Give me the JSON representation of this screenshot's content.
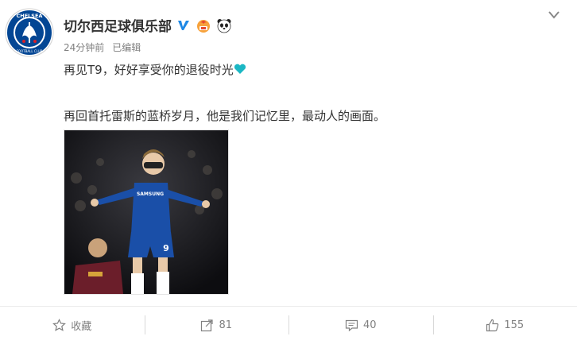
{
  "post": {
    "author_name": "切尔西足球俱乐部",
    "time": "24分钟前",
    "edited": "已编辑",
    "text_line1": "再见T9，好好享受你的退役时光",
    "text_line2": "再回首托雷斯的蓝桥岁月，他是我们记忆里，最动人的画面。",
    "avatar_text_top": "CHELSEA",
    "avatar_text_bottom": "FOOTBALL CLUB",
    "verified_badge": "V",
    "heart_color": "#1bb7c4",
    "brand_color": "#034694"
  },
  "actions": {
    "favorite_label": "收藏",
    "repost_count": "81",
    "comment_count": "40",
    "like_count": "155"
  },
  "photo": {
    "jersey_sponsor": "SAMSUNG",
    "shirt_number": "9"
  },
  "icons": [
    "chelsea-crest",
    "verified-icon",
    "flame-emoji-icon",
    "panda-emoji-icon",
    "chevron-down-icon",
    "heart-icon",
    "star-icon",
    "share-icon",
    "comment-icon",
    "thumbs-up-icon"
  ]
}
